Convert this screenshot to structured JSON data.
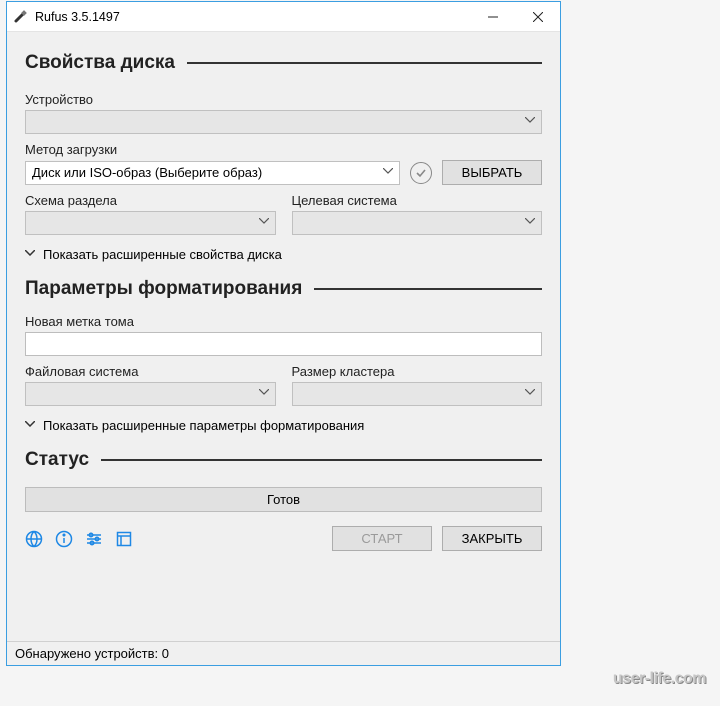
{
  "titlebar": {
    "title": "Rufus 3.5.1497"
  },
  "sections": {
    "drive_props": "Свойства диска",
    "format_opts": "Параметры форматирования",
    "status": "Статус"
  },
  "labels": {
    "device": "Устройство",
    "boot_method": "Метод загрузки",
    "partition_scheme": "Схема раздела",
    "target_system": "Целевая система",
    "show_advanced_drive": "Показать расширенные свойства диска",
    "volume_label": "Новая метка тома",
    "file_system": "Файловая система",
    "cluster_size": "Размер кластера",
    "show_advanced_format": "Показать расширенные параметры форматирования"
  },
  "values": {
    "device": "",
    "boot_method": "Диск или ISO-образ (Выберите образ)",
    "partition_scheme": "",
    "target_system": "",
    "volume_label": "",
    "file_system": "",
    "cluster_size": "",
    "status_text": "Готов"
  },
  "buttons": {
    "select": "ВЫБРАТЬ",
    "start": "СТАРТ",
    "close": "ЗАКРЫТЬ"
  },
  "footer": {
    "devices_found": "Обнаружено устройств: 0"
  },
  "watermark": "user-life.com"
}
